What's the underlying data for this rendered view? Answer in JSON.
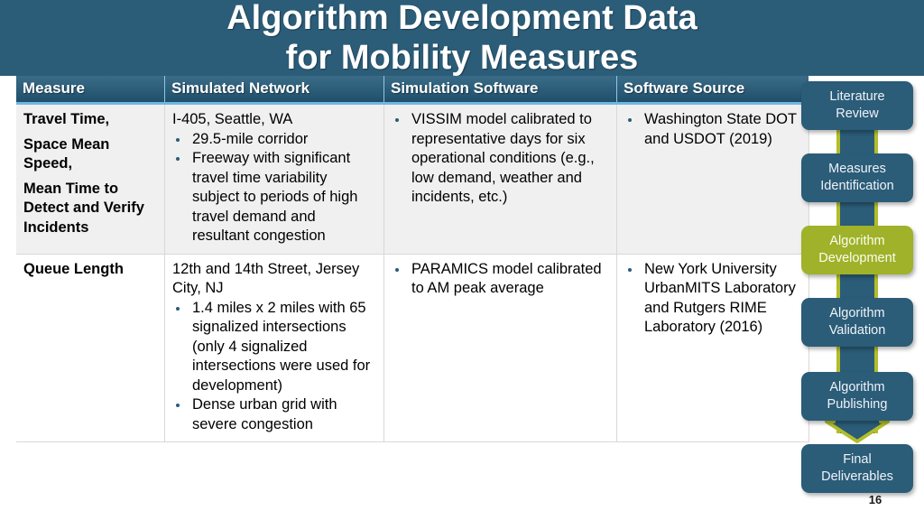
{
  "slide": {
    "title": "Algorithm Development Data\nfor Mobility Measures",
    "page_number": "16"
  },
  "colors": {
    "banner": "#2b5c78",
    "header_row": "#1f4f6b",
    "header_underline": "#6fb8e0",
    "row_shaded": "#f0f0f0",
    "row_plain": "#ffffff",
    "bullet": "#2b5c78",
    "flow_box": "#2b5c78",
    "flow_box_active": "#9fb229",
    "flow_connector_outline": "#b2bd2a",
    "title_text": "#ffffff"
  },
  "table": {
    "headers": [
      "Measure",
      "Simulated Network",
      "Simulation Software",
      "Software Source"
    ],
    "rows": [
      {
        "measure_lines": [
          "Travel Time,",
          "Space Mean Speed,",
          "Mean Time to Detect and Verify Incidents"
        ],
        "network_lead": "I-405, Seattle, WA",
        "network_bullets": [
          "29.5-mile corridor",
          "Freeway with significant travel time variability subject to periods of high travel demand and resultant congestion"
        ],
        "software_lead": "",
        "software_bullets": [
          "VISSIM model calibrated to representative days for six operational conditions (e.g., low demand, weather and incidents, etc.)"
        ],
        "source_lead": "",
        "source_bullets": [
          "Washington State DOT and USDOT (2019)"
        ]
      },
      {
        "measure_lines": [
          "Queue Length"
        ],
        "network_lead": "12th and 14th Street, Jersey City, NJ",
        "network_bullets": [
          "1.4 miles x 2 miles with 65 signalized intersections (only 4 signalized intersections were used for development)",
          "Dense urban grid with severe congestion"
        ],
        "software_lead": "",
        "software_bullets": [
          "PARAMICS model calibrated to AM peak average"
        ],
        "source_lead": "",
        "source_bullets": [
          "New York University UrbanMITS Laboratory and Rutgers RIME Laboratory (2016)"
        ]
      }
    ]
  },
  "flowchart": {
    "steps": [
      {
        "label": "Literature\nReview",
        "active": false
      },
      {
        "label": "Measures\nIdentification",
        "active": false
      },
      {
        "label": "Algorithm\nDevelopment",
        "active": true
      },
      {
        "label": "Algorithm\nValidation",
        "active": false
      },
      {
        "label": "Algorithm\nPublishing",
        "active": false
      },
      {
        "label": "Final\nDeliverables",
        "active": false
      }
    ]
  }
}
